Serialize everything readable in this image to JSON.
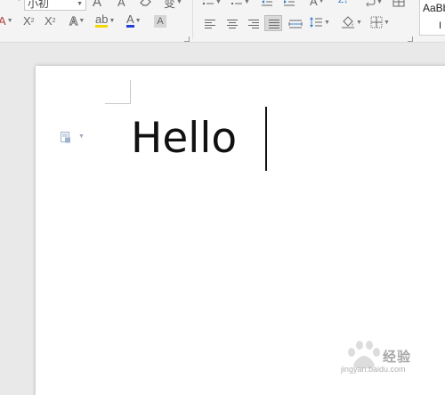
{
  "ribbon": {
    "font_size": {
      "value": "小初"
    },
    "font_group": {
      "grow_font_glyph": "A",
      "shrink_font_glyph": "A",
      "phonetic_glyph": "变",
      "superscript_glyph": "X",
      "subscript_glyph": "X",
      "text_effect_glyph": "A",
      "highlight_glyph": "ab",
      "font_color_glyph": "A",
      "char_shading_glyph": "A"
    },
    "paragraph_group": {
      "sort_glyph": "A",
      "sort_sub": "Z↓"
    },
    "styles": {
      "preview_text": "AaBbCcDd",
      "second_row": "I"
    },
    "colors": {
      "font_color_underline": "#1f3fd8",
      "highlight_underline": "#f2d600"
    }
  },
  "document": {
    "text": "Hello"
  },
  "watermark": {
    "brand_cn": "经验",
    "url": "jingyan.baidu.com"
  }
}
